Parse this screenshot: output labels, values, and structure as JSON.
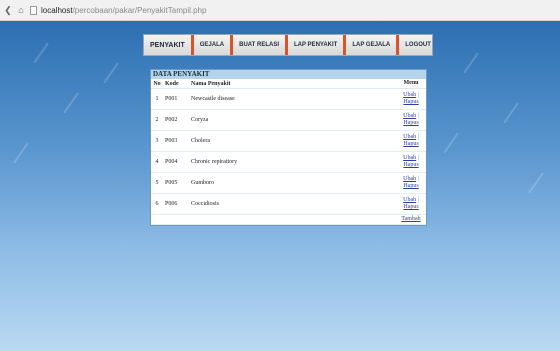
{
  "browser": {
    "url_host": "localhost",
    "url_path": "/percobaan/pakar/PenyakitTampil.php"
  },
  "menu": [
    "PENYAKIT",
    "GEJALA",
    "BUAT RELASI",
    "LAP PENYAKIT",
    "LAP GEJALA",
    "LOGOUT"
  ],
  "panel_title": "DATA PENYAKIT",
  "table": {
    "headers": {
      "no": "No",
      "kode": "Kode",
      "nama": "Nama Penyakit",
      "menu": "Menu"
    },
    "rows": [
      {
        "no": "1",
        "kode": "P001",
        "nama": "Newcastle disease"
      },
      {
        "no": "2",
        "kode": "P002",
        "nama": "Coryza"
      },
      {
        "no": "3",
        "kode": "P003",
        "nama": "Cholera"
      },
      {
        "no": "4",
        "kode": "P004",
        "nama": "Chronic repirattory"
      },
      {
        "no": "5",
        "kode": "P005",
        "nama": "Gumboro"
      },
      {
        "no": "6",
        "kode": "P006",
        "nama": "Coccidiosis"
      }
    ],
    "edit_label": "Ubah",
    "delete_label": "Hapus",
    "separator": "|",
    "add_label": "Tambah"
  }
}
